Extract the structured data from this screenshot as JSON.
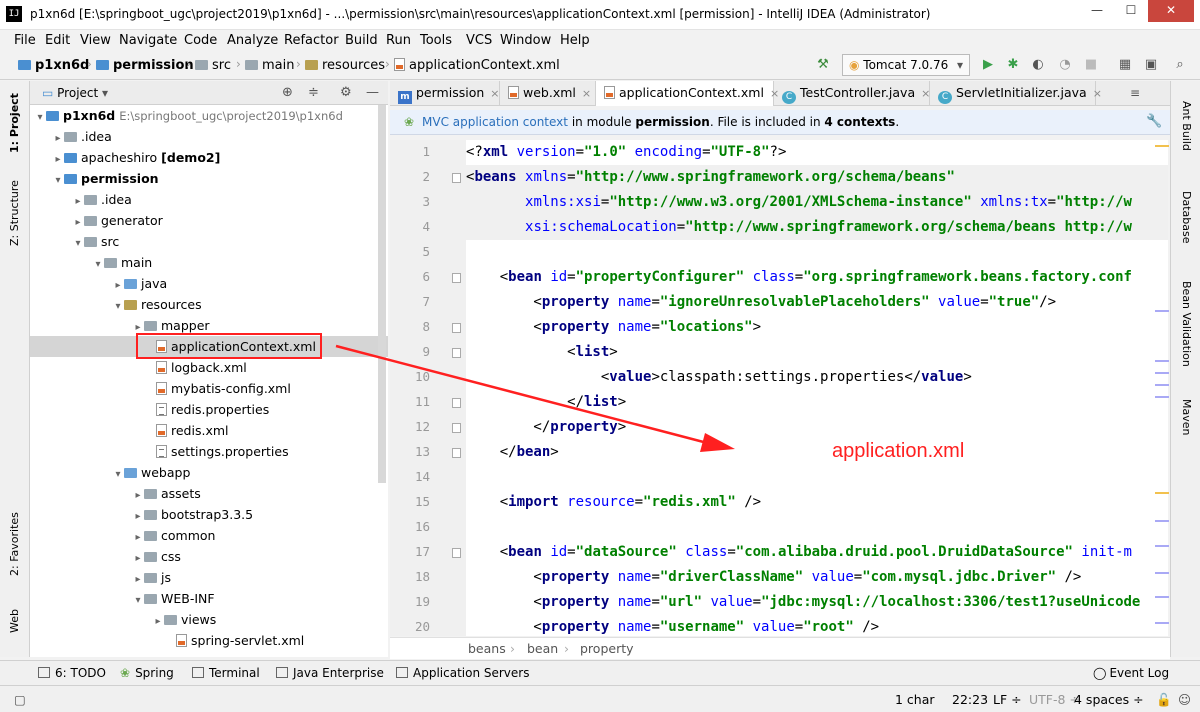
{
  "window": {
    "title": "p1xn6d [E:\\springboot_ugc\\project2019\\p1xn6d] - ...\\permission\\src\\main\\resources\\applicationContext.xml [permission] - IntelliJ IDEA (Administrator)",
    "app_icon": "IJ",
    "minimize": "—",
    "maximize": "☐",
    "close": "✕"
  },
  "menu": [
    "File",
    "Edit",
    "View",
    "Navigate",
    "Code",
    "Analyze",
    "Refactor",
    "Build",
    "Run",
    "Tools",
    "VCS",
    "Window",
    "Help"
  ],
  "navbar": {
    "crumbs": [
      "p1xn6d",
      "permission",
      "src",
      "main",
      "resources",
      "applicationContext.xml"
    ],
    "run_config": "Tomcat 7.0.76"
  },
  "left_strip": [
    "1: Project",
    "Z: Structure",
    "2: Favorites",
    "Web"
  ],
  "right_strip": [
    "Ant Build",
    "Database",
    "Bean Validation",
    "Maven"
  ],
  "project_panel": {
    "title": "Project",
    "tree": [
      {
        "label": "p1xn6d",
        "suffix": "E:\\springboot_ugc\\project2019\\p1xn6d",
        "bold": true
      },
      {
        "label": ".idea"
      },
      {
        "label": "apacheshiro",
        "suffix": "[demo2]"
      },
      {
        "label": "permission",
        "bold": true
      },
      {
        "label": ".idea"
      },
      {
        "label": "generator"
      },
      {
        "label": "src"
      },
      {
        "label": "main"
      },
      {
        "label": "java"
      },
      {
        "label": "resources"
      },
      {
        "label": "mapper"
      },
      {
        "label": "applicationContext.xml"
      },
      {
        "label": "logback.xml"
      },
      {
        "label": "mybatis-config.xml"
      },
      {
        "label": "redis.properties"
      },
      {
        "label": "redis.xml"
      },
      {
        "label": "settings.properties"
      },
      {
        "label": "webapp"
      },
      {
        "label": "assets"
      },
      {
        "label": "bootstrap3.3.5"
      },
      {
        "label": "common"
      },
      {
        "label": "css"
      },
      {
        "label": "js"
      },
      {
        "label": "WEB-INF"
      },
      {
        "label": "views"
      },
      {
        "label": "spring-servlet.xml"
      }
    ]
  },
  "tabs": [
    "permission",
    "web.xml",
    "applicationContext.xml",
    "TestController.java",
    "ServletInitializer.java"
  ],
  "notice": {
    "link": "MVC application context",
    "part1": " in module ",
    "module": "permission",
    "part2": ". File is included in ",
    "count": "4 contexts",
    "part3": "."
  },
  "code_lines": [
    {
      "n": "1",
      "segs": [
        [
          "x",
          "<?"
        ],
        [
          "t",
          "xml "
        ],
        [
          "a",
          "version"
        ],
        [
          "x",
          "="
        ],
        [
          "v",
          "\"1.0\""
        ],
        [
          "x",
          " "
        ],
        [
          "a",
          "encoding"
        ],
        [
          "x",
          "="
        ],
        [
          "v",
          "\"UTF-8\""
        ],
        [
          "x",
          "?>"
        ]
      ]
    },
    {
      "n": "2",
      "segs": [
        [
          "x",
          "<"
        ],
        [
          "t",
          "beans "
        ],
        [
          "a",
          "xmlns"
        ],
        [
          "x",
          "="
        ],
        [
          "v",
          "\"http://www.springframework.org/schema/beans\""
        ]
      ]
    },
    {
      "n": "3",
      "segs": [
        [
          "x",
          "       "
        ],
        [
          "a",
          "xmlns:xsi"
        ],
        [
          "x",
          "="
        ],
        [
          "v",
          "\"http://www.w3.org/2001/XMLSchema-instance\""
        ],
        [
          "x",
          " "
        ],
        [
          "a",
          "xmlns:tx"
        ],
        [
          "x",
          "="
        ],
        [
          "v",
          "\"http://w"
        ]
      ]
    },
    {
      "n": "4",
      "segs": [
        [
          "x",
          "       "
        ],
        [
          "a",
          "xsi:schemaLocation"
        ],
        [
          "x",
          "="
        ],
        [
          "v",
          "\"http://www.springframework.org/schema/beans http://w"
        ]
      ]
    },
    {
      "n": "5",
      "segs": []
    },
    {
      "n": "6",
      "segs": [
        [
          "x",
          "    <"
        ],
        [
          "t",
          "bean "
        ],
        [
          "a",
          "id"
        ],
        [
          "x",
          "="
        ],
        [
          "v",
          "\"propertyConfigurer\""
        ],
        [
          "x",
          " "
        ],
        [
          "a",
          "class"
        ],
        [
          "x",
          "="
        ],
        [
          "v",
          "\"org.springframework.beans.factory.conf"
        ]
      ]
    },
    {
      "n": "7",
      "segs": [
        [
          "x",
          "        <"
        ],
        [
          "t",
          "property "
        ],
        [
          "a",
          "name"
        ],
        [
          "x",
          "="
        ],
        [
          "v",
          "\"ignoreUnresolvablePlaceholders\""
        ],
        [
          "x",
          " "
        ],
        [
          "a",
          "value"
        ],
        [
          "x",
          "="
        ],
        [
          "v",
          "\"true\""
        ],
        [
          "x",
          "/>"
        ]
      ]
    },
    {
      "n": "8",
      "segs": [
        [
          "x",
          "        <"
        ],
        [
          "t",
          "property "
        ],
        [
          "a",
          "name"
        ],
        [
          "x",
          "="
        ],
        [
          "v",
          "\"locations\""
        ],
        [
          "x",
          ">"
        ]
      ]
    },
    {
      "n": "9",
      "segs": [
        [
          "x",
          "            <"
        ],
        [
          "t",
          "list"
        ],
        [
          "x",
          ">"
        ]
      ]
    },
    {
      "n": "10",
      "segs": [
        [
          "x",
          "                <"
        ],
        [
          "t",
          "value"
        ],
        [
          "x",
          ">classpath:settings.properties</"
        ],
        [
          "t",
          "value"
        ],
        [
          "x",
          ">"
        ]
      ]
    },
    {
      "n": "11",
      "segs": [
        [
          "x",
          "            </"
        ],
        [
          "t",
          "list"
        ],
        [
          "x",
          ">"
        ]
      ]
    },
    {
      "n": "12",
      "segs": [
        [
          "x",
          "        </"
        ],
        [
          "t",
          "property"
        ],
        [
          "x",
          ">"
        ]
      ]
    },
    {
      "n": "13",
      "segs": [
        [
          "x",
          "    </"
        ],
        [
          "t",
          "bean"
        ],
        [
          "x",
          ">"
        ]
      ]
    },
    {
      "n": "14",
      "segs": []
    },
    {
      "n": "15",
      "segs": [
        [
          "x",
          "    <"
        ],
        [
          "t",
          "import "
        ],
        [
          "a",
          "resource"
        ],
        [
          "x",
          "="
        ],
        [
          "v",
          "\"redis.xml\""
        ],
        [
          "x",
          " />"
        ]
      ]
    },
    {
      "n": "16",
      "segs": []
    },
    {
      "n": "17",
      "segs": [
        [
          "x",
          "    <"
        ],
        [
          "t",
          "bean "
        ],
        [
          "a",
          "id"
        ],
        [
          "x",
          "="
        ],
        [
          "v",
          "\"dataSource\""
        ],
        [
          "x",
          " "
        ],
        [
          "a",
          "class"
        ],
        [
          "x",
          "="
        ],
        [
          "v",
          "\"com.alibaba.druid.pool.DruidDataSource\""
        ],
        [
          "x",
          " "
        ],
        [
          "a",
          "init-m"
        ]
      ]
    },
    {
      "n": "18",
      "segs": [
        [
          "x",
          "        <"
        ],
        [
          "t",
          "property "
        ],
        [
          "a",
          "name"
        ],
        [
          "x",
          "="
        ],
        [
          "v",
          "\"driverClassName\""
        ],
        [
          "x",
          " "
        ],
        [
          "a",
          "value"
        ],
        [
          "x",
          "="
        ],
        [
          "v",
          "\"com.mysql.jdbc.Driver\""
        ],
        [
          "x",
          " />"
        ]
      ]
    },
    {
      "n": "19",
      "segs": [
        [
          "x",
          "        <"
        ],
        [
          "t",
          "property "
        ],
        [
          "a",
          "name"
        ],
        [
          "x",
          "="
        ],
        [
          "v",
          "\"url\""
        ],
        [
          "x",
          " "
        ],
        [
          "a",
          "value"
        ],
        [
          "x",
          "="
        ],
        [
          "v",
          "\"jdbc:mysql://localhost:3306/test1?useUnicode"
        ]
      ]
    },
    {
      "n": "20",
      "segs": [
        [
          "x",
          "        <"
        ],
        [
          "t",
          "property "
        ],
        [
          "a",
          "name"
        ],
        [
          "x",
          "="
        ],
        [
          "v",
          "\"username\""
        ],
        [
          "x",
          " "
        ],
        [
          "a",
          "value"
        ],
        [
          "x",
          "="
        ],
        [
          "v",
          "\"root\""
        ],
        [
          "x",
          " />"
        ]
      ]
    }
  ],
  "editor_breadcrumbs": [
    "beans",
    "bean",
    "property"
  ],
  "annotation": "application.xml",
  "toolwindows": [
    "6: TODO",
    "Spring",
    "Terminal",
    "Java Enterprise",
    "Application Servers"
  ],
  "event_log": "Event Log",
  "status": {
    "chars": "1 char",
    "position": "22:23",
    "line_sep": "LF ÷",
    "encoding": "UTF-8 ÷",
    "indent": "4 spaces ÷"
  }
}
